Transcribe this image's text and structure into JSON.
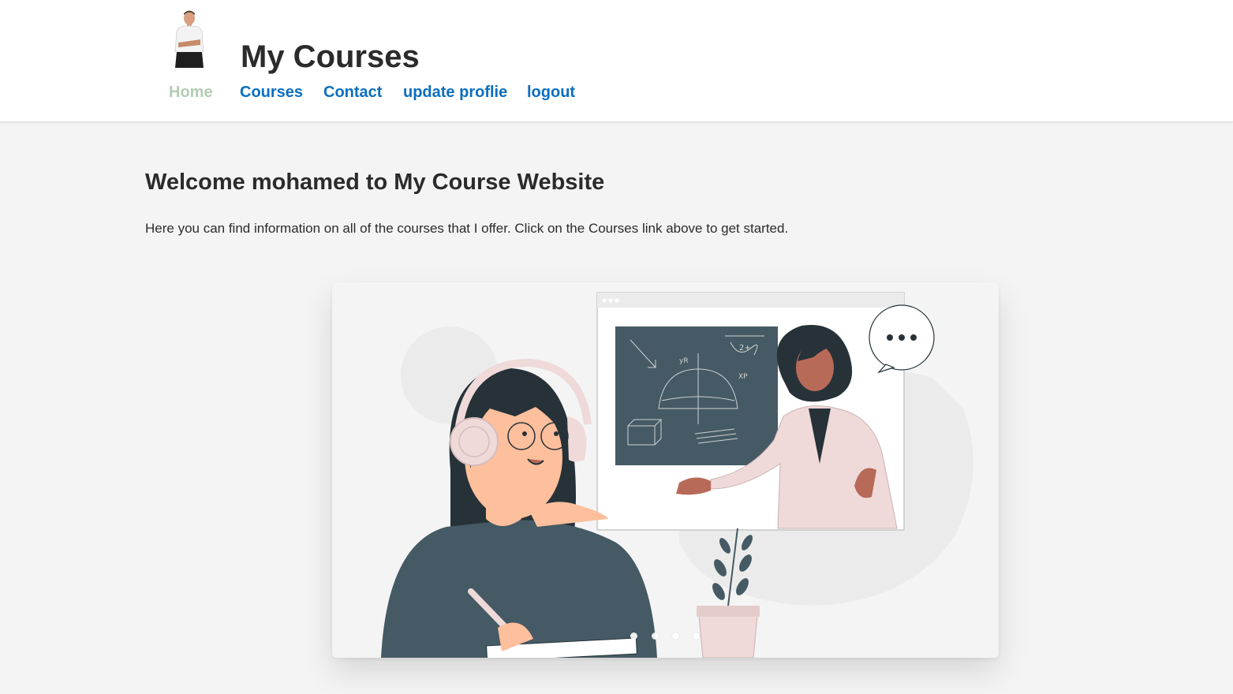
{
  "header": {
    "title": "My Courses",
    "avatar_alt": "profile-photo",
    "nav": [
      {
        "label": "Home",
        "active": true
      },
      {
        "label": "Courses",
        "active": false
      },
      {
        "label": "Contact",
        "active": false
      },
      {
        "label": "update proflie",
        "active": false
      },
      {
        "label": "logout",
        "active": false
      }
    ]
  },
  "main": {
    "welcome": "Welcome mohamed to My Course Website",
    "intro": "Here you can find information on all of the courses that I offer. Click on the Courses link above to get started."
  },
  "carousel": {
    "slide_count": 4,
    "active_index": 0,
    "slide_image": "online-learning-illustration"
  },
  "colors": {
    "nav_link": "#0b6fbf",
    "nav_active": "#b3ccb3",
    "page_bg": "#f4f4f4",
    "header_bg": "#ffffff"
  }
}
